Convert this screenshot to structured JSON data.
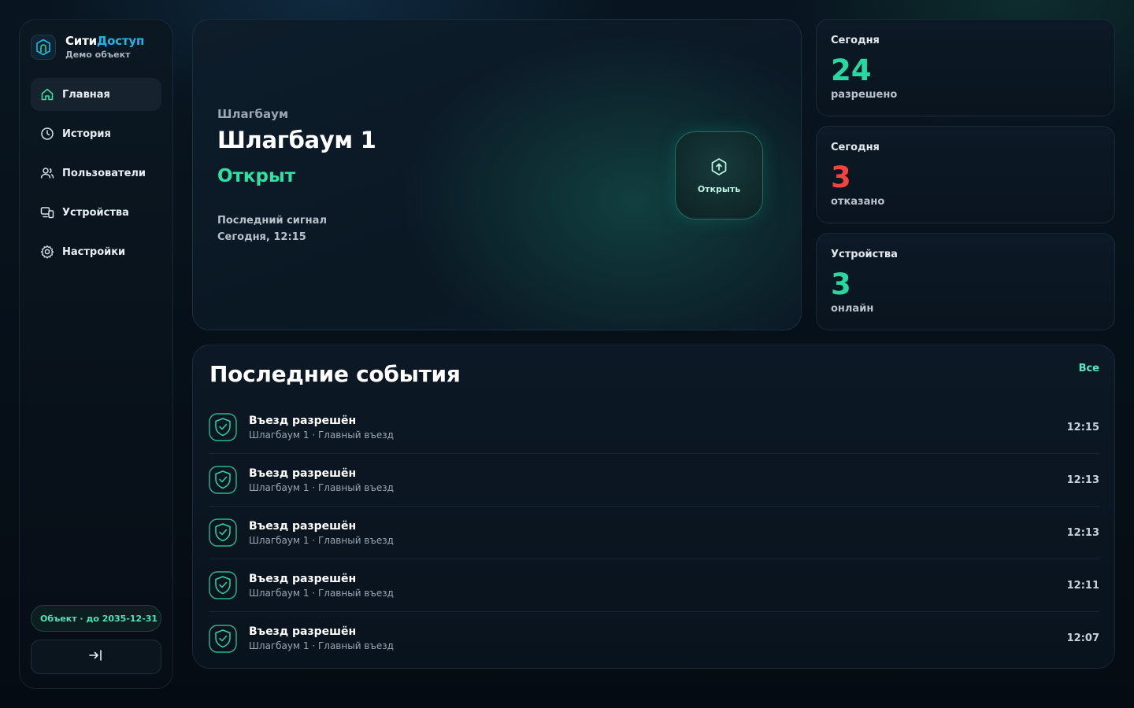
{
  "brand": {
    "name_part1": "Сити",
    "name_part2": "Доступ",
    "subtitle": "Демо объект",
    "accent_color": "#1eb6ea"
  },
  "sidebar": {
    "items": [
      {
        "label": "Главная",
        "icon": "home-icon",
        "active": true
      },
      {
        "label": "История",
        "icon": "clock-icon",
        "active": false
      },
      {
        "label": "Пользователи",
        "icon": "users-icon",
        "active": false
      },
      {
        "label": "Устройства",
        "icon": "devices-icon",
        "active": false
      },
      {
        "label": "Настройки",
        "icon": "gear-icon",
        "active": false
      }
    ],
    "license": "Объект · до 2035-12-31",
    "logout_icon": "logout-icon"
  },
  "hero": {
    "kicker": "Шлагбаум",
    "title": "Шлагбаум 1",
    "status": "Открыт",
    "status_color": "#2ee2a4",
    "signal_label": "Последний сигнал",
    "signal_value": "Сегодня, 12:15",
    "open_button_label": "Открыть"
  },
  "stats": [
    {
      "label": "Сегодня",
      "value": "24",
      "sub": "разрешено",
      "color": "#26d9a0"
    },
    {
      "label": "Сегодня",
      "value": "3",
      "sub": "отказано",
      "color": "#f0443f"
    },
    {
      "label": "Устройства",
      "value": "3",
      "sub": "онлайн",
      "color": "#26d9a0"
    }
  ],
  "events": {
    "title": "Последние события",
    "all_link": "Все",
    "items": [
      {
        "title": "Въезд разрешён",
        "sub": "Шлагбаум 1 · Главный въезд",
        "time": "12:15"
      },
      {
        "title": "Въезд разрешён",
        "sub": "Шлагбаум 1 · Главный въезд",
        "time": "12:13"
      },
      {
        "title": "Въезд разрешён",
        "sub": "Шлагбаум 1 · Главный въезд",
        "time": "12:13"
      },
      {
        "title": "Въезд разрешён",
        "sub": "Шлагбаум 1 · Главный въезд",
        "time": "12:11"
      },
      {
        "title": "Въезд разрешён",
        "sub": "Шлагбаум 1 · Главный въезд",
        "time": "12:07"
      }
    ]
  }
}
